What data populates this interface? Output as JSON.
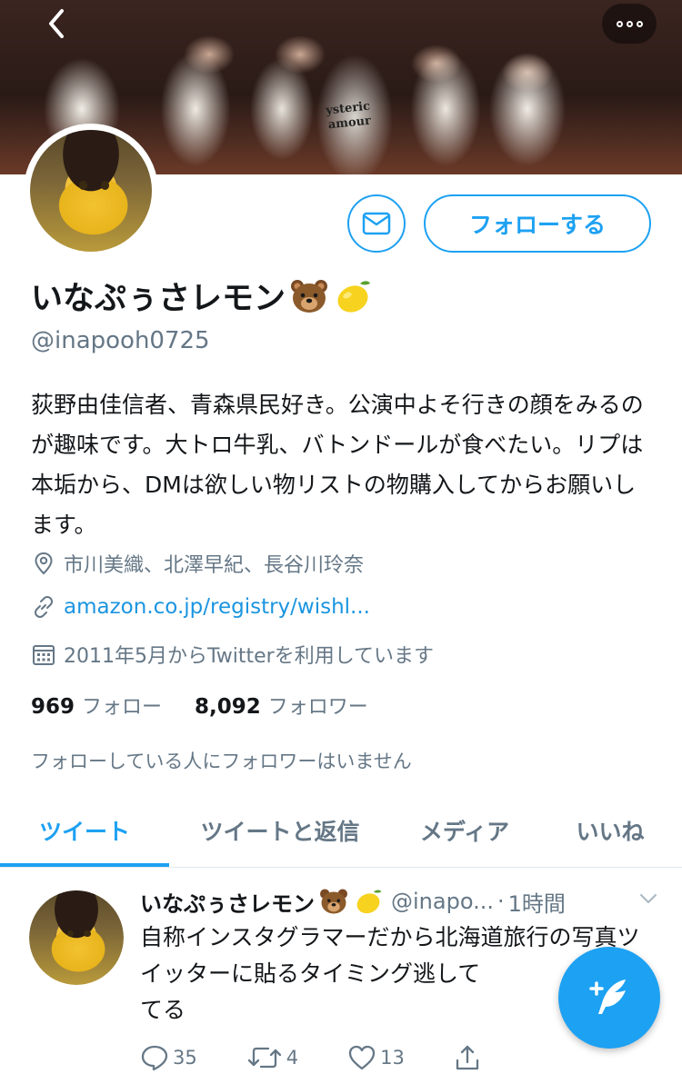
{
  "header": {
    "back_icon": "chevron-left-icon",
    "more_icon": "more-dots-icon"
  },
  "banner": {
    "shirt_text": "ysteric\namour"
  },
  "profile": {
    "name": "いなぷぅさレモン",
    "name_emojis": [
      "bear-face-emoji",
      "lemon-emoji"
    ],
    "handle": "@inapooh0725",
    "bio": "荻野由佳信者、青森県民好き。公演中よそ行きの顔をみるのが趣味です。大トロ牛乳、バトンドールが食べたい。リプは本垢から、DMは欲しい物リストの物購入してからお願いします。",
    "location": "市川美織、北澤早紀、長谷川玲奈",
    "link": "amazon.co.jp/registry/wishl...",
    "joined": "2011年5月からTwitterを利用しています",
    "following_count": "969",
    "following_label": "フォロー",
    "followers_count": "8,092",
    "followers_label": "フォロワー",
    "no_common_followers": "フォローしている人にフォロワーはいません"
  },
  "buttons": {
    "follow_label": "フォローする",
    "dm_icon": "envelope-icon"
  },
  "tabs": [
    {
      "label": "ツイート",
      "active": true
    },
    {
      "label": "ツイートと返信",
      "active": false
    },
    {
      "label": "メディア",
      "active": false
    },
    {
      "label": "いいね",
      "active": false
    }
  ],
  "tweet": {
    "name": "いなぷぅさレモン",
    "handle": "@inapo...",
    "separator": "·",
    "time": "1時間",
    "text": "自称インスタグラマーだから北海道旅行の写真ツイッターに貼るタイミング逃してるてる",
    "text_visible": "自称インスタグラマーだから北海道旅行の写真ツイッターに貼るタイミング逃して　　　\nてる",
    "reply_count": "35",
    "retweet_count": "4",
    "like_count": "13"
  },
  "colors": {
    "accent": "#1da1f2",
    "secondary_text": "#657786",
    "link": "#1b95e0"
  }
}
